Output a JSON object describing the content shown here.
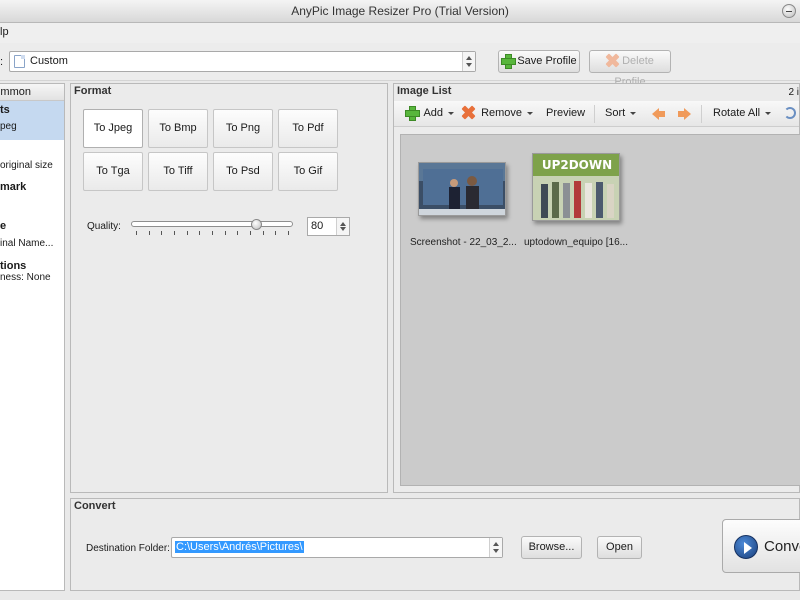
{
  "window": {
    "title": "AnyPic Image Resizer Pro (Trial Version)"
  },
  "menu": {
    "help": "lp"
  },
  "profile": {
    "label": ":",
    "value": "Custom",
    "save_label": "Save Profile",
    "delete_label": "Delete Profile"
  },
  "sidebar": {
    "header": "Common",
    "items": [
      "ts",
      "peg",
      "original size",
      "mark",
      "e",
      "inal Name...",
      "tions",
      "ness: None"
    ]
  },
  "format": {
    "title": "Format",
    "buttons": [
      "To Jpeg",
      "To Bmp",
      "To Png",
      "To Pdf",
      "To Tga",
      "To Tiff",
      "To Psd",
      "To Gif"
    ],
    "quality_label": "Quality:",
    "quality_value": "80",
    "quality_level": 0.78
  },
  "image_list": {
    "title": "Image List",
    "count": "2 i",
    "toolbar": {
      "add": "Add",
      "remove": "Remove",
      "preview": "Preview",
      "sort": "Sort",
      "rotate_all": "Rotate All"
    },
    "images": [
      {
        "caption": "Screenshot - 22_03_2..."
      },
      {
        "caption": "uptodown_equipo [16...",
        "banner": "UP2DOWN"
      }
    ]
  },
  "convert": {
    "title": "Convert",
    "dest_label": "Destination Folder:",
    "dest_value": "C:\\Users\\Andrés\\Pictures\\",
    "browse": "Browse...",
    "open": "Open",
    "convert_label": "Convert"
  }
}
